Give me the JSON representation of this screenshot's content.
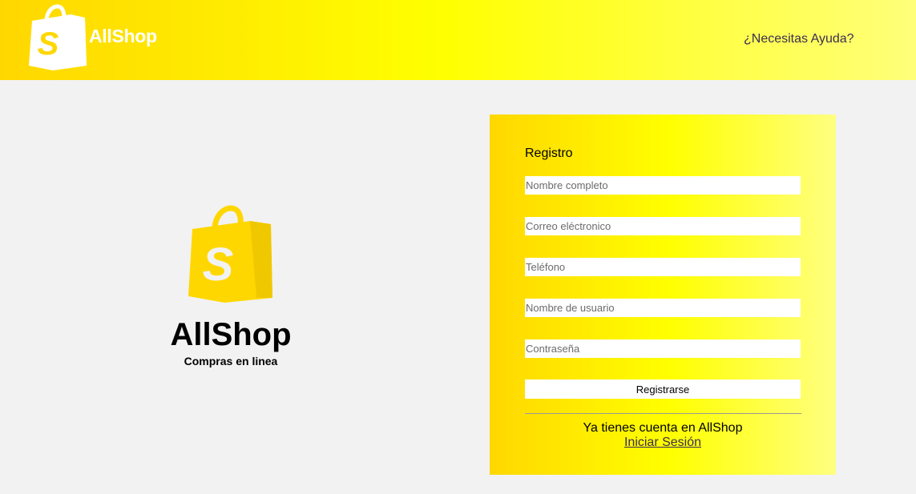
{
  "header": {
    "brand": "AllShop",
    "help_link": "¿Necesitas Ayuda?",
    "logo_icon": "shopping-bag-s-icon"
  },
  "hero": {
    "title": "AllShop",
    "subtitle": "Compras en linea",
    "logo_icon": "shopping-bag-s-icon"
  },
  "register": {
    "title": "Registro",
    "fields": {
      "full_name": {
        "placeholder": "Nombre completo",
        "value": ""
      },
      "email": {
        "placeholder": "Correo eléctronico",
        "value": ""
      },
      "phone": {
        "placeholder": "Teléfono",
        "value": ""
      },
      "username": {
        "placeholder": "Nombre de usuario",
        "value": ""
      },
      "password": {
        "placeholder": "Contraseña",
        "value": ""
      }
    },
    "submit_label": "Registrarse",
    "account_text": "Ya tienes cuenta en AllShop",
    "login_link": "Iniciar Sesión"
  },
  "colors": {
    "brand_yellow": "#ffd700",
    "bright_yellow": "#ffff00",
    "pale_yellow": "#ffff80",
    "background": "#f2f2f2",
    "link_text": "#3b2e4f"
  }
}
